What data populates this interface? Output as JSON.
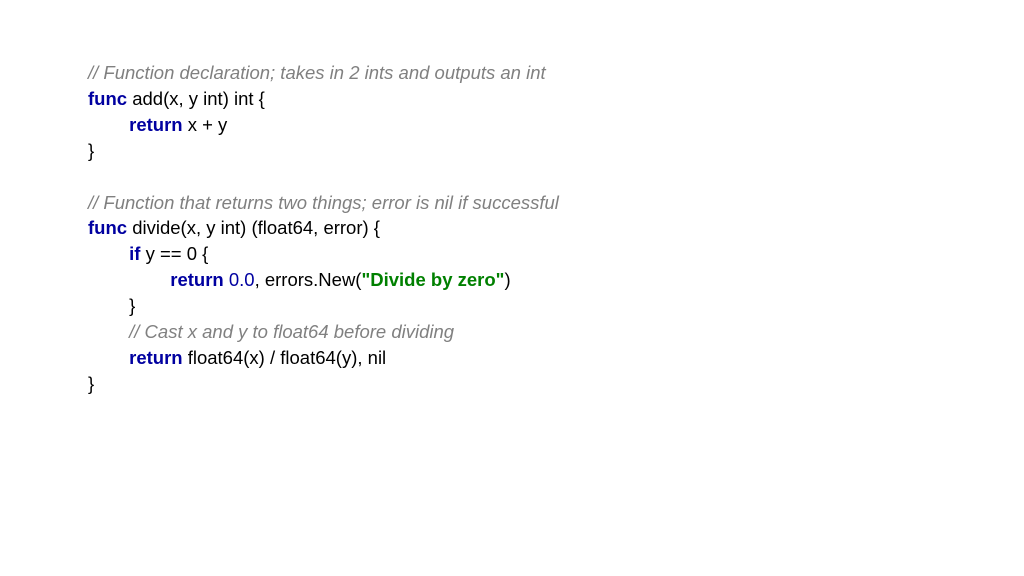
{
  "lines": [
    {
      "tokens": [
        {
          "cls": "comment",
          "t": "// Function declaration; takes in 2 ints and outputs an int"
        }
      ]
    },
    {
      "tokens": [
        {
          "cls": "keyword",
          "t": "func"
        },
        {
          "cls": "plain",
          "t": " add(x, y int) int {"
        }
      ]
    },
    {
      "tokens": [
        {
          "cls": "plain",
          "t": "        "
        },
        {
          "cls": "keyword",
          "t": "return"
        },
        {
          "cls": "plain",
          "t": " x + y"
        }
      ]
    },
    {
      "tokens": [
        {
          "cls": "plain",
          "t": "}"
        }
      ]
    },
    {
      "blank": true
    },
    {
      "tokens": [
        {
          "cls": "comment",
          "t": "// Function that returns two things; error is nil if successful"
        }
      ]
    },
    {
      "tokens": [
        {
          "cls": "keyword",
          "t": "func"
        },
        {
          "cls": "plain",
          "t": " divide(x, y int) (float64, error) {"
        }
      ]
    },
    {
      "tokens": [
        {
          "cls": "plain",
          "t": "        "
        },
        {
          "cls": "keyword",
          "t": "if"
        },
        {
          "cls": "plain",
          "t": " y == 0 {"
        }
      ]
    },
    {
      "tokens": [
        {
          "cls": "plain",
          "t": "                "
        },
        {
          "cls": "keyword",
          "t": "return"
        },
        {
          "cls": "plain",
          "t": " "
        },
        {
          "cls": "number",
          "t": "0.0"
        },
        {
          "cls": "plain",
          "t": ", errors.New("
        },
        {
          "cls": "string",
          "t": "\"Divide by zero\""
        },
        {
          "cls": "plain",
          "t": ")"
        }
      ]
    },
    {
      "tokens": [
        {
          "cls": "plain",
          "t": "        }"
        }
      ]
    },
    {
      "tokens": [
        {
          "cls": "plain",
          "t": "        "
        },
        {
          "cls": "comment",
          "t": "// Cast x and y to float64 before dividing"
        }
      ]
    },
    {
      "tokens": [
        {
          "cls": "plain",
          "t": "        "
        },
        {
          "cls": "keyword",
          "t": "return"
        },
        {
          "cls": "plain",
          "t": " float64(x) / float64(y), nil"
        }
      ]
    },
    {
      "tokens": [
        {
          "cls": "plain",
          "t": "}"
        }
      ]
    }
  ]
}
